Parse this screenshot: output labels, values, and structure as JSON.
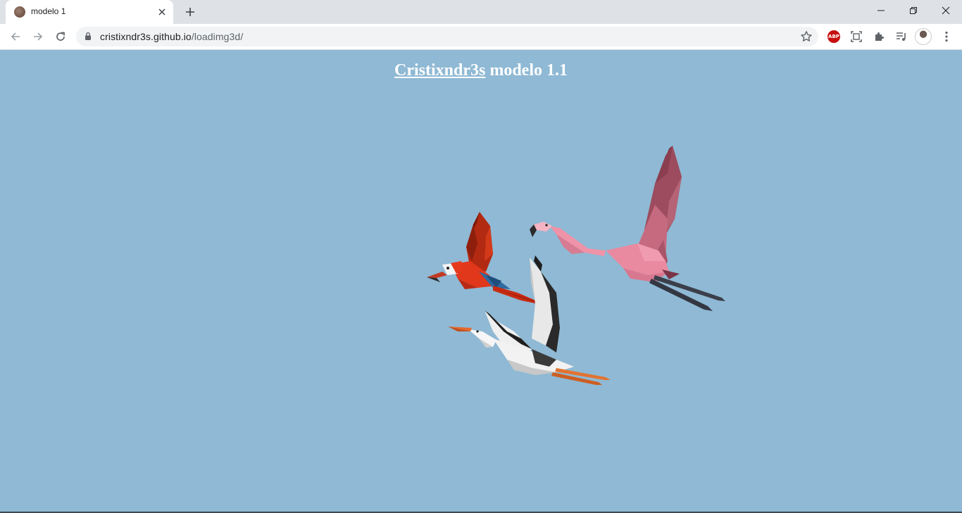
{
  "browser": {
    "tab": {
      "title": "modelo 1"
    },
    "address": {
      "host": "cristixndr3s.github.io",
      "path": "/loadimg3d/"
    },
    "extensions": {
      "abp_label": "ABP"
    }
  },
  "page": {
    "title_link": "Cristixndr3s",
    "title_rest": "modelo 1.1",
    "background_color": "#8fb9d4"
  },
  "scene": {
    "birds": [
      "flamingo",
      "parrot",
      "stork"
    ]
  },
  "icons": {
    "back": "arrow-left-icon",
    "forward": "arrow-right-icon",
    "reload": "reload-icon",
    "lock": "lock-icon",
    "star": "star-icon",
    "extensions": "puzzle-icon",
    "media": "media-queue-icon",
    "menu": "kebab-menu-icon"
  }
}
